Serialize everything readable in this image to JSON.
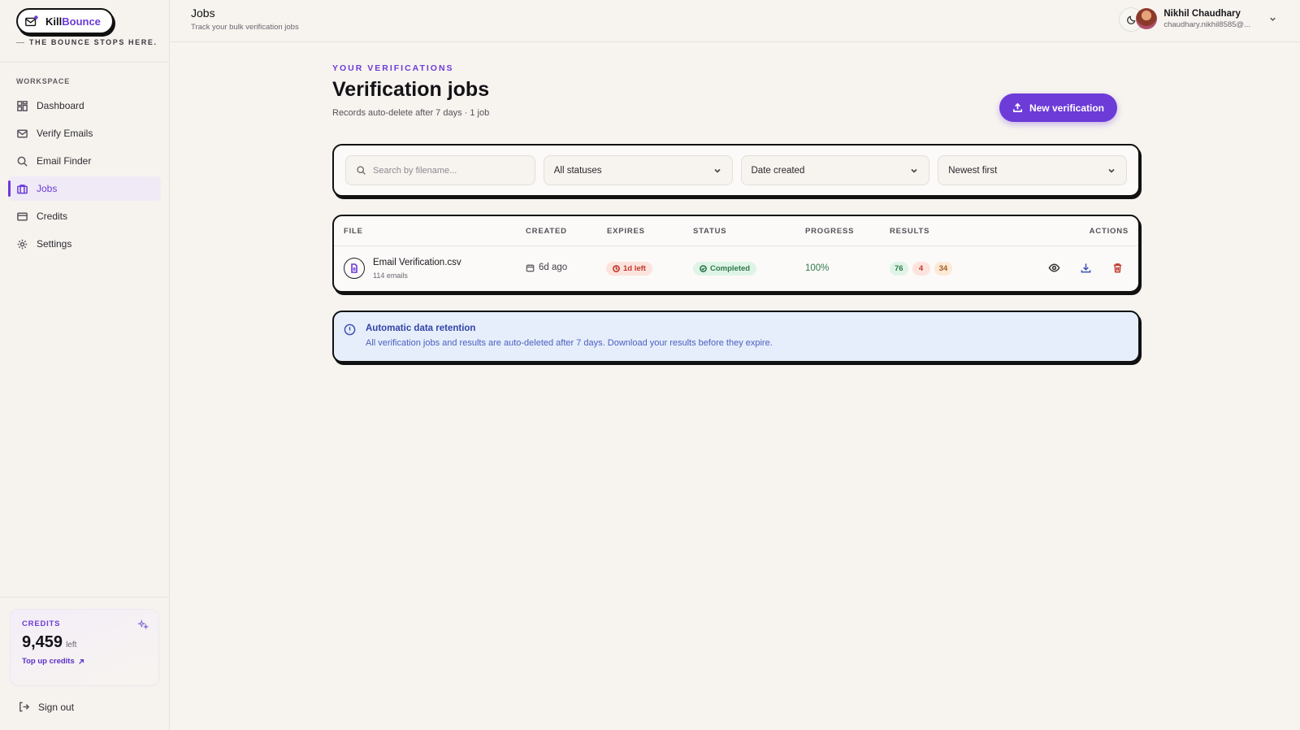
{
  "brand": {
    "name_part1": "Kill",
    "name_part2": "Bounce",
    "tagline": "THE BOUNCE STOPS HERE."
  },
  "sidebar": {
    "section_label": "WORKSPACE",
    "items": [
      {
        "label": "Dashboard",
        "icon": "dashboard-icon"
      },
      {
        "label": "Verify Emails",
        "icon": "mail-icon"
      },
      {
        "label": "Email Finder",
        "icon": "search-icon"
      },
      {
        "label": "Jobs",
        "icon": "briefcase-icon",
        "active": true
      },
      {
        "label": "Credits",
        "icon": "card-icon"
      },
      {
        "label": "Settings",
        "icon": "gear-icon"
      }
    ],
    "credits": {
      "label": "CREDITS",
      "value": "9,459",
      "suffix": "left",
      "topup": "Top up credits"
    },
    "signout": "Sign out"
  },
  "topbar": {
    "title": "Jobs",
    "subtitle": "Track your bulk verification jobs",
    "user": {
      "name": "Nikhil Chaudhary",
      "email": "chaudhary.nikhil8585@..."
    }
  },
  "main": {
    "eyebrow": "YOUR VERIFICATIONS",
    "title": "Verification jobs",
    "meta": "Records auto-delete after 7 days · 1 job",
    "new_button": "New verification",
    "filters": {
      "search_placeholder": "Search by filename...",
      "status": "All statuses",
      "date": "Date created",
      "sort": "Newest first"
    },
    "table": {
      "headers": {
        "file": "FILE",
        "created": "CREATED",
        "expires": "EXPIRES",
        "status": "STATUS",
        "progress": "PROGRESS",
        "results": "RESULTS",
        "actions": "ACTIONS"
      },
      "rows": [
        {
          "file_name": "Email Verification.csv",
          "file_count": "114 emails",
          "created": "6d ago",
          "expires": "1d left",
          "status": "Completed",
          "progress": "100%",
          "results": {
            "valid": "76",
            "invalid": "4",
            "risky": "34"
          }
        }
      ]
    },
    "notice": {
      "title": "Automatic data retention",
      "text": "All verification jobs and results are auto-deleted after 7 days. Download your results before they expire."
    }
  },
  "colors": {
    "accent": "#6d3bd8",
    "background": "#f7f4ef",
    "success": "#2f7a4b",
    "danger": "#c0392b"
  }
}
